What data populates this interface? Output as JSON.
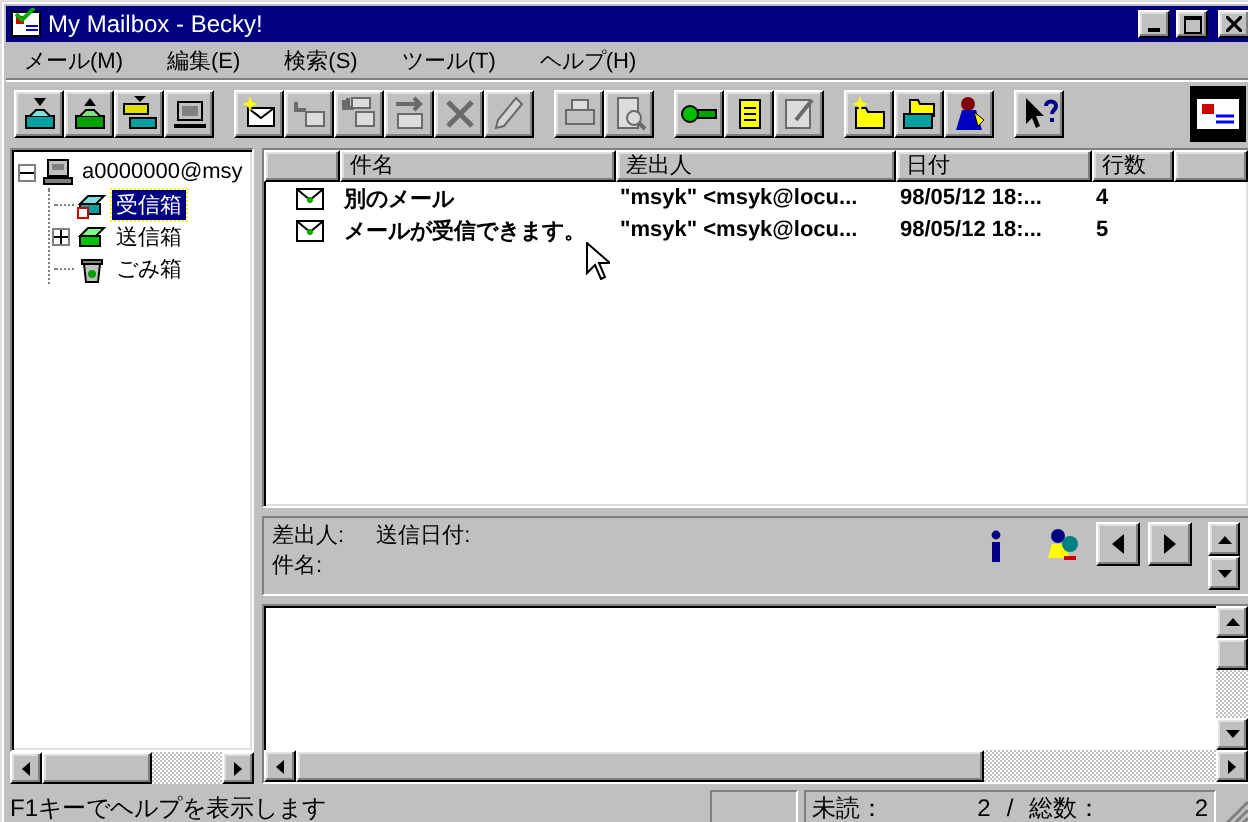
{
  "window": {
    "title": "My Mailbox - Becky!"
  },
  "menu": [
    "メール(M)",
    "編集(E)",
    "検索(S)",
    "ツール(T)",
    "ヘルプ(H)"
  ],
  "toolbar": [
    [
      {
        "kind": "get-mail",
        "disabled": false
      },
      {
        "kind": "send-mail",
        "disabled": false
      },
      {
        "kind": "send-receive",
        "disabled": false
      },
      {
        "kind": "computer",
        "disabled": false
      }
    ],
    [
      {
        "kind": "new-mail",
        "disabled": false
      },
      {
        "kind": "reply",
        "disabled": true
      },
      {
        "kind": "reply-all",
        "disabled": true
      },
      {
        "kind": "forward",
        "disabled": true
      },
      {
        "kind": "delete",
        "disabled": true
      },
      {
        "kind": "edit",
        "disabled": true
      }
    ],
    [
      {
        "kind": "print",
        "disabled": true
      },
      {
        "kind": "preview",
        "disabled": true
      }
    ],
    [
      {
        "kind": "settings",
        "disabled": false
      },
      {
        "kind": "notepad",
        "disabled": false
      },
      {
        "kind": "memo",
        "disabled": true
      }
    ],
    [
      {
        "kind": "new-folder",
        "disabled": false
      },
      {
        "kind": "folders",
        "disabled": false
      },
      {
        "kind": "user",
        "disabled": false
      }
    ],
    [
      {
        "kind": "help",
        "disabled": false
      }
    ]
  ],
  "tree": [
    {
      "label": "a0000000@msy",
      "kind": "computer",
      "expanded": true,
      "selected": false,
      "children": [
        {
          "label": "受信箱",
          "kind": "inbox",
          "selected": true
        },
        {
          "label": "送信箱",
          "kind": "outbox",
          "expanded": false,
          "selected": false
        },
        {
          "label": "ごみ箱",
          "kind": "trash",
          "selected": false
        }
      ]
    }
  ],
  "message_list": {
    "columns": [
      "件名",
      "差出人",
      "日付",
      "行数"
    ],
    "rows": [
      {
        "cells": [
          "別のメール",
          "\"msyk\" <msyk@locu...",
          "98/05/12 18:...",
          "4"
        ],
        "selected": false
      },
      {
        "cells": [
          "メールが受信できます。",
          "\"msyk\" <msyk@locu...",
          "98/05/12 18:...",
          "5"
        ],
        "selected": false
      }
    ]
  },
  "preview_header": {
    "from_label": "差出人:",
    "date_label": "送信日付:",
    "subject_label": "件名:"
  },
  "status_bar": {
    "message": "F1キーでヘルプを表示します",
    "unread_label": "未読：",
    "unread": "2",
    "separator": "/",
    "total_label": "総数：",
    "total": "2"
  }
}
